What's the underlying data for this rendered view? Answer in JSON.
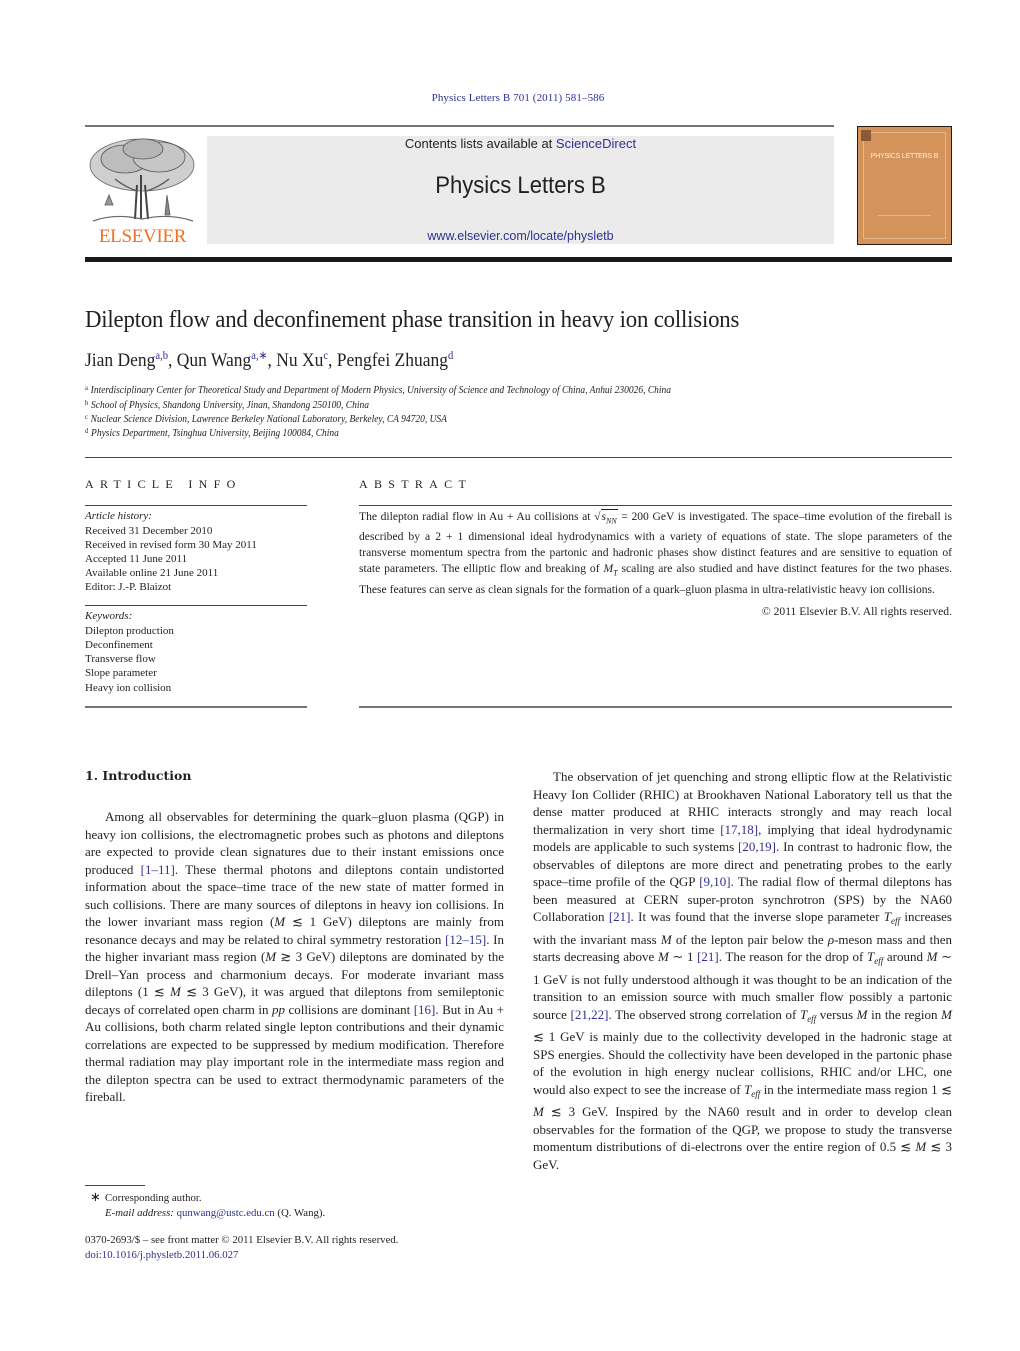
{
  "journal_ref": "Physics Letters B 701 (2011) 581–586",
  "header": {
    "publisher": "ELSEVIER",
    "contents_prefix": "Contents lists available at ",
    "contents_link": "ScienceDirect",
    "journal_title": "Physics Letters B",
    "journal_url": "www.elsevier.com/locate/physletb",
    "cover_title": "PHYSICS LETTERS B"
  },
  "article": {
    "title": "Dilepton flow and deconfinement phase transition in heavy ion collisions",
    "authors": [
      {
        "name": "Jian Deng",
        "affil": "a,b",
        "sep": ", "
      },
      {
        "name": "Qun Wang",
        "affil": "a,∗",
        "sep": ", "
      },
      {
        "name": "Nu Xu",
        "affil": "c",
        "sep": ", "
      },
      {
        "name": "Pengfei Zhuang",
        "affil": "d",
        "sep": ""
      }
    ],
    "affiliations": [
      {
        "mark": "a",
        "text": "Interdisciplinary Center for Theoretical Study and Department of Modern Physics, University of Science and Technology of China, Anhui 230026, China"
      },
      {
        "mark": "b",
        "text": "School of Physics, Shandong University, Jinan, Shandong 250100, China"
      },
      {
        "mark": "c",
        "text": "Nuclear Science Division, Lawrence Berkeley National Laboratory, Berkeley, CA 94720, USA"
      },
      {
        "mark": "d",
        "text": "Physics Department, Tsinghua University, Beijing 100084, China"
      }
    ]
  },
  "article_info": {
    "heading": "ARTICLE INFO",
    "history_label": "Article history:",
    "history": [
      "Received 31 December 2010",
      "Received in revised form 30 May 2011",
      "Accepted 11 June 2011",
      "Available online 21 June 2011",
      "Editor: J.-P. Blaizot"
    ],
    "keywords_label": "Keywords:",
    "keywords": [
      "Dilepton production",
      "Deconfinement",
      "Transverse flow",
      "Slope parameter",
      "Heavy ion collision"
    ]
  },
  "abstract": {
    "heading": "ABSTRACT",
    "p1": "The dilepton radial flow in Au + Au collisions at ",
    "sqrt_sym": "√",
    "s_nn": "s",
    "s_nn_sub": "NN",
    "p2": " = 200 GeV is investigated. The space–time evolution of the fireball is described by a 2 + 1 dimensional ideal hydrodynamics with a variety of equations of state. The slope parameters of the transverse momentum spectra from the partonic and hadronic phases show distinct features and are sensitive to equation of state parameters. The elliptic flow and breaking of ",
    "mt": "M",
    "mt_sub": "T",
    "p3": " scaling are also studied and have distinct features for the two phases. These features can serve as clean signals for the formation of a quark–gluon plasma in ultra-relativistic heavy ion collisions.",
    "copyright": "© 2011 Elsevier B.V. All rights reserved."
  },
  "section": {
    "heading": "1. Introduction",
    "left": [
      {
        "t": "Among all observables for determining the quark–gluon plasma (QGP) in heavy ion collisions, the electromagnetic probes such as photons and dileptons are expected to provide clean signatures due to their instant emissions once produced "
      },
      {
        "ref": "[1–11]"
      },
      {
        "t": ". These thermal photons and dileptons contain undistorted information about the space–time trace of the new state of matter formed in such collisions. There are many sources of dileptons in heavy ion collisions. In the lower invariant mass region ("
      },
      {
        "i": "M"
      },
      {
        "t": " ≲ 1 GeV) dileptons are mainly from resonance decays and may be related to chiral symmetry restoration "
      },
      {
        "ref": "[12–15]"
      },
      {
        "t": ". In the higher invariant mass region ("
      },
      {
        "i": "M"
      },
      {
        "t": " ≳ 3 GeV) dileptons are dominated by the Drell–Yan process and charmonium decays. For moderate invariant mass dileptons (1 ≲ "
      },
      {
        "i": "M"
      },
      {
        "t": " ≲ 3 GeV), it was argued that dileptons from semileptonic decays of correlated open charm in "
      },
      {
        "i": "pp"
      },
      {
        "t": " collisions are dominant "
      },
      {
        "ref": "[16]"
      },
      {
        "t": ". But in Au + Au collisions, both charm related single lepton contributions and their dynamic correlations are expected to be suppressed by medium modification. Therefore thermal radiation may play important role in the intermediate mass region and the dilepton spectra can be used to extract thermodynamic parameters of the fireball."
      }
    ],
    "right": [
      {
        "t": "The observation of jet quenching and strong elliptic flow at the Relativistic Heavy Ion Collider (RHIC) at Brookhaven National Laboratory tell us that the dense matter produced at RHIC interacts strongly and may reach local thermalization in very short time "
      },
      {
        "ref": "[17,18]"
      },
      {
        "t": ", implying that ideal hydrodynamic models are applicable to such systems "
      },
      {
        "ref": "[20,19]"
      },
      {
        "t": ". In contrast to hadronic flow, the observables of dileptons are more direct and penetrating probes to the early space–time profile of the QGP "
      },
      {
        "ref": "[9,10]"
      },
      {
        "t": ". The radial flow of thermal dileptons has been measured at CERN super-proton synchrotron (SPS) by the NA60 Collaboration "
      },
      {
        "ref": "[21]"
      },
      {
        "t": ". It was found that the inverse slope parameter "
      },
      {
        "teff": true
      },
      {
        "t": " increases with the invariant mass "
      },
      {
        "i": "M"
      },
      {
        "t": " of the lepton pair below the "
      },
      {
        "i": "ρ"
      },
      {
        "t": "-meson mass and then starts decreasing above "
      },
      {
        "i": "M"
      },
      {
        "t": " ∼ 1 "
      },
      {
        "ref": "[21]"
      },
      {
        "t": ". The reason for the drop of "
      },
      {
        "teff": true
      },
      {
        "t": " around "
      },
      {
        "i": "M"
      },
      {
        "t": " ∼ 1 GeV is not fully understood although it was thought to be an indication of the transition to an emission source with much smaller flow possibly a partonic source "
      },
      {
        "ref": "[21,22]"
      },
      {
        "t": ". The observed strong correlation of "
      },
      {
        "teff": true
      },
      {
        "t": " versus "
      },
      {
        "i": "M"
      },
      {
        "t": " in the region "
      },
      {
        "i": "M"
      },
      {
        "t": " ≲ 1 GeV is mainly due to the collectivity developed in the hadronic stage at SPS energies. Should the collectivity have been developed in the partonic phase of the evolution in high energy nuclear collisions, RHIC and/or LHC, one would also expect to see the increase of "
      },
      {
        "teff": true
      },
      {
        "t": " in the intermediate mass region 1 ≲ "
      },
      {
        "i": "M"
      },
      {
        "t": " ≲ 3 GeV. Inspired by the NA60 result and in order to develop clean observables for the formation of the QGP, we propose to study the transverse momentum distributions of di-electrons over the entire region of 0.5 ≲ "
      },
      {
        "i": "M"
      },
      {
        "t": " ≲ 3 GeV."
      }
    ],
    "teff_main": "T",
    "teff_sub": "eff"
  },
  "footnotes": {
    "star": "∗",
    "corresponding": "Corresponding author.",
    "email_label": "E-mail address:",
    "email": "qunwang@ustc.edu.cn",
    "email_suffix": " (Q. Wang).",
    "issn": "0370-2693/$ – see front matter  © 2011 Elsevier B.V. All rights reserved.",
    "doi": "doi:10.1016/j.physletb.2011.06.027"
  },
  "colors": {
    "link": "#2e3192",
    "elsevier_orange": "#f26f21",
    "header_gray": "#ebebeb",
    "cover": "#d4935a"
  }
}
